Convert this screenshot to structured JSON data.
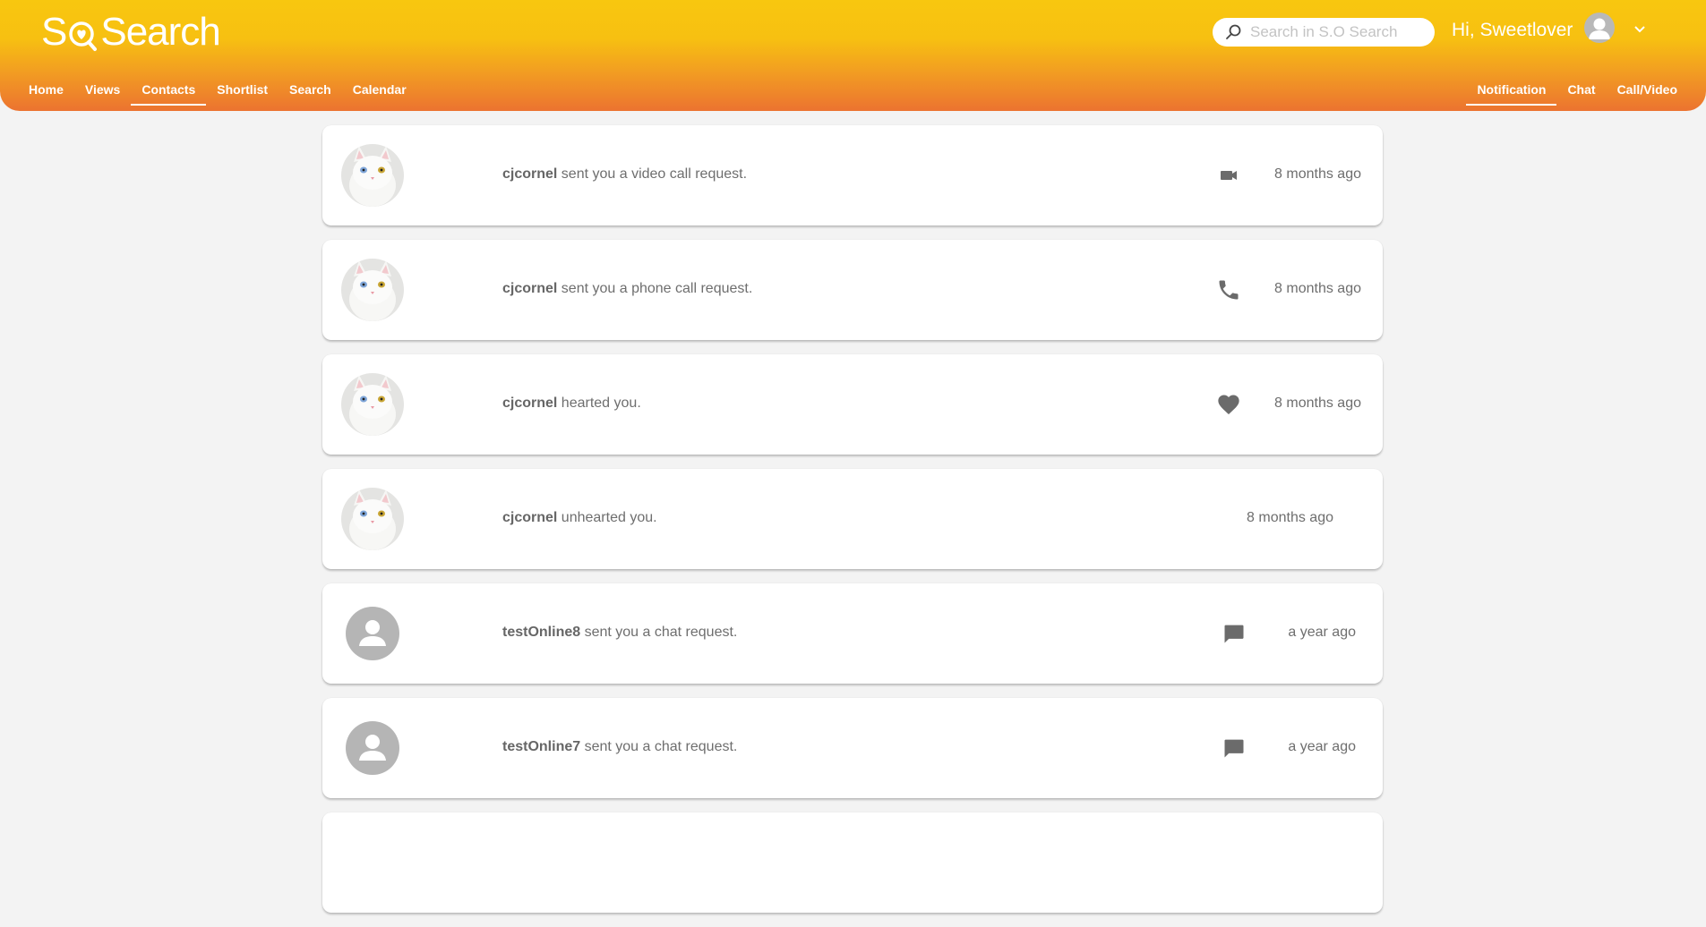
{
  "app": {
    "logo_left": "S",
    "logo_right": "Search",
    "search_placeholder": "Search in S.O Search",
    "greeting": "Hi, Sweetlover",
    "colors": {
      "header_top": "#f8c70f",
      "header_bottom": "#ec7330",
      "icon_gray": "#6b6b6b"
    }
  },
  "nav_left": [
    {
      "label": "Home",
      "active": false
    },
    {
      "label": "Views",
      "active": false
    },
    {
      "label": "Contacts",
      "active": true
    },
    {
      "label": "Shortlist",
      "active": false
    },
    {
      "label": "Search",
      "active": false
    },
    {
      "label": "Calendar",
      "active": false
    }
  ],
  "nav_right": [
    {
      "label": "Notification",
      "active": true
    },
    {
      "label": "Chat",
      "active": false
    },
    {
      "label": "Call/Video",
      "active": false
    }
  ],
  "notifications": [
    {
      "user": "cjcornel",
      "text": " sent you a video call request.",
      "icon": "video-camera-icon",
      "time": "8 months ago",
      "avatar": "cat-photo"
    },
    {
      "user": "cjcornel",
      "text": " sent you a phone call request.",
      "icon": "phone-icon",
      "time": "8 months ago",
      "avatar": "cat-photo"
    },
    {
      "user": "cjcornel",
      "text": " hearted you.",
      "icon": "heart-icon",
      "time": "8 months ago",
      "avatar": "cat-photo"
    },
    {
      "user": "cjcornel",
      "text": " unhearted you.",
      "icon": "",
      "time": "8 months ago",
      "avatar": "cat-photo"
    },
    {
      "user": "testOnline8",
      "text": " sent you a chat request.",
      "icon": "chat-bubble-icon",
      "time": "a year ago",
      "avatar": "default-user"
    },
    {
      "user": "testOnline7",
      "text": " sent you a chat request.",
      "icon": "chat-bubble-icon",
      "time": "a year ago",
      "avatar": "default-user"
    }
  ]
}
